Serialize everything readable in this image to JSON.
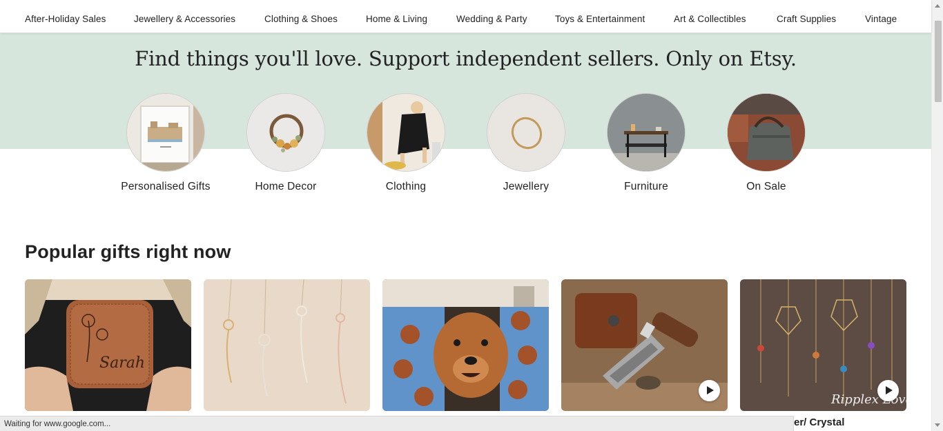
{
  "nav": {
    "items": [
      "After-Holiday Sales",
      "Jewellery & Accessories",
      "Clothing & Shoes",
      "Home & Living",
      "Wedding & Party",
      "Toys & Entertainment",
      "Art & Collectibles",
      "Craft Supplies",
      "Vintage"
    ]
  },
  "hero": {
    "title": "Find things you'll love. Support independent sellers. Only on Etsy.",
    "colors": {
      "band": "#d7e6dd"
    }
  },
  "categories": [
    {
      "label": "Personalised Gifts",
      "icon": "framed-house-print"
    },
    {
      "label": "Home Decor",
      "icon": "dried-flower-wreath"
    },
    {
      "label": "Clothing",
      "icon": "woman-in-black-dress"
    },
    {
      "label": "Jewellery",
      "icon": "gold-ring"
    },
    {
      "label": "Furniture",
      "icon": "side-table"
    },
    {
      "label": "On Sale",
      "icon": "canvas-bag"
    }
  ],
  "popular": {
    "title": "Popular gifts right now",
    "cards": [
      {
        "image": "leather-jewelry-box",
        "engraving": "Sarah",
        "video": false
      },
      {
        "image": "birth-flower-name-necklaces",
        "video": false
      },
      {
        "image": "custom-dog-face-blanket",
        "video": false
      },
      {
        "image": "damascus-folding-knife",
        "video": true
      },
      {
        "image": "crystal-suncatchers",
        "watermark": "Ripplex Love",
        "video": true
      }
    ],
    "visible_caption": "er/ Crystal"
  },
  "status": {
    "text": "Waiting for www.google.com..."
  }
}
